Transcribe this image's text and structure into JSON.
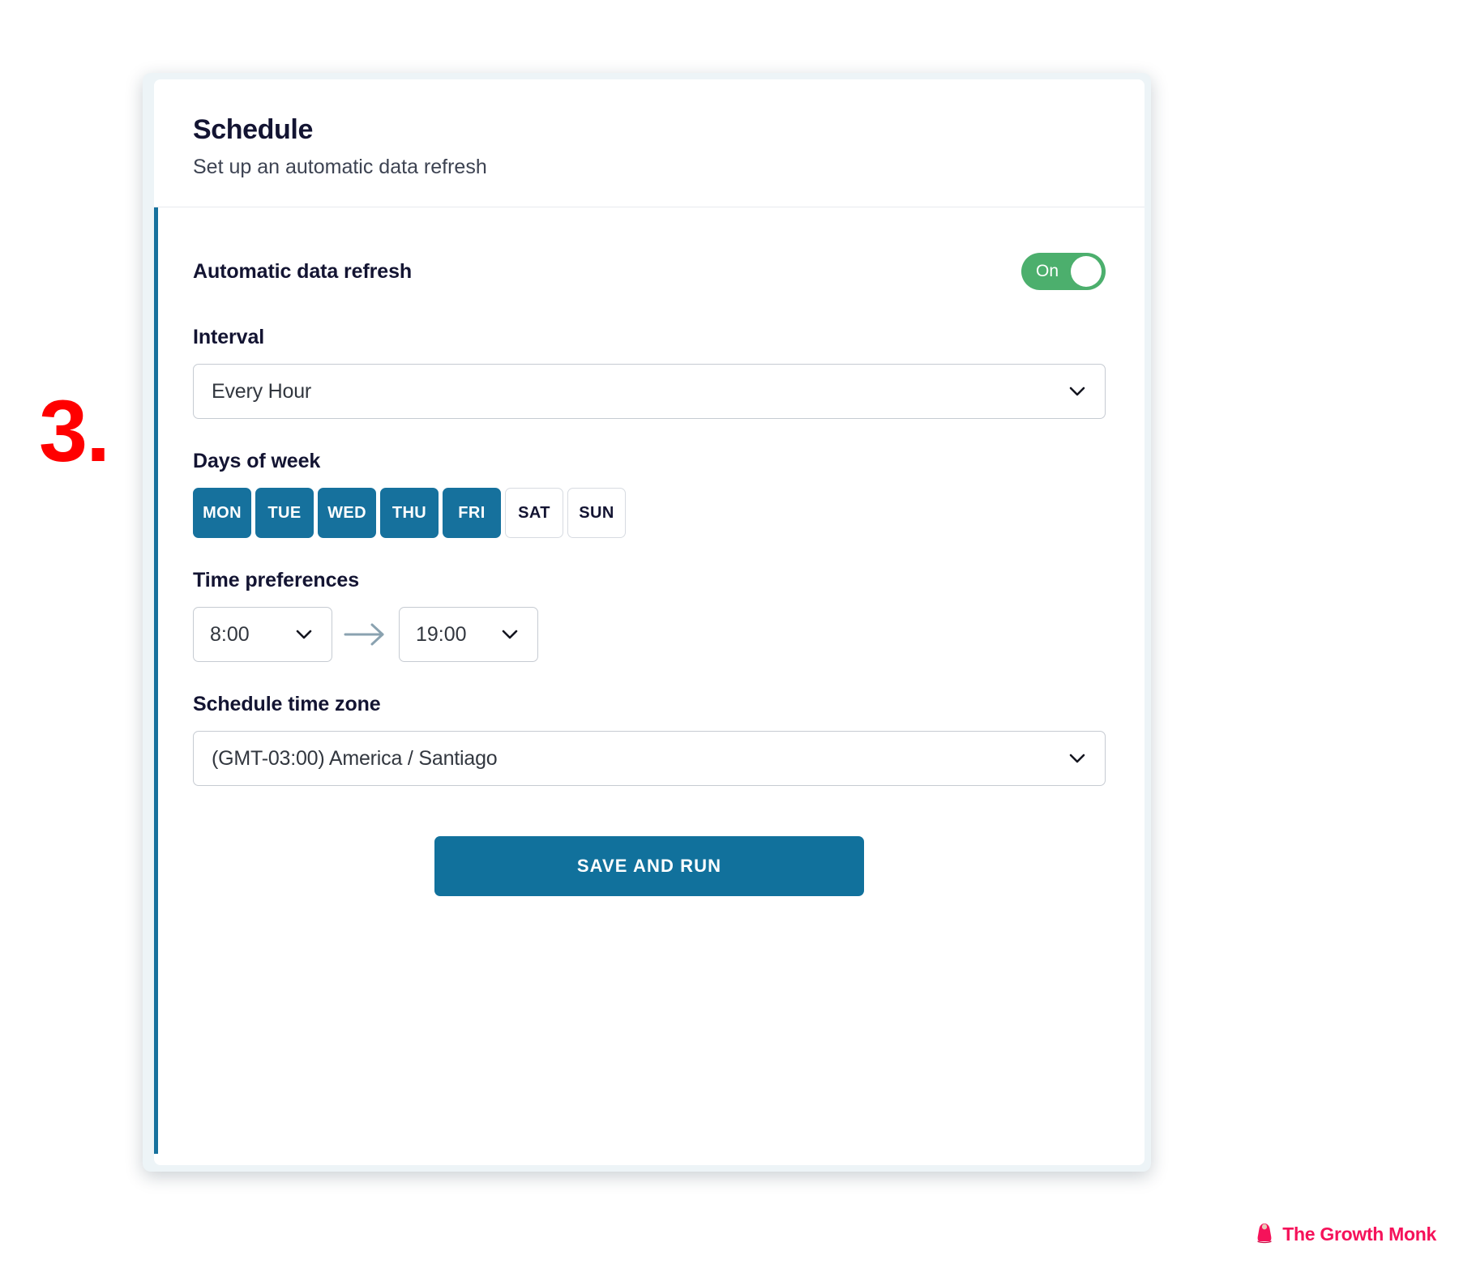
{
  "annotation": {
    "step": "3."
  },
  "card": {
    "header": {
      "title": "Schedule",
      "subtitle": "Set up an automatic data refresh"
    },
    "auto_refresh": {
      "label": "Automatic data refresh",
      "toggle_state": "On",
      "toggle_color": "#4caf6d"
    },
    "interval": {
      "label": "Interval",
      "value": "Every Hour",
      "chevron": "chevron-down-icon"
    },
    "days_of_week": {
      "label": "Days of week",
      "selected_color": "#16719d",
      "days": [
        {
          "label": "MON",
          "selected": true
        },
        {
          "label": "TUE",
          "selected": true
        },
        {
          "label": "WED",
          "selected": true
        },
        {
          "label": "THU",
          "selected": true
        },
        {
          "label": "FRI",
          "selected": true
        },
        {
          "label": "SAT",
          "selected": false
        },
        {
          "label": "SUN",
          "selected": false
        }
      ]
    },
    "time_preferences": {
      "label": "Time preferences",
      "start": "8:00",
      "end": "19:00",
      "separator_icon": "arrow-right-icon"
    },
    "time_zone": {
      "label": "Schedule time zone",
      "value": "(GMT-03:00) America / Santiago",
      "chevron": "chevron-down-icon"
    },
    "actions": {
      "save_label": "SAVE AND RUN",
      "save_color": "#11719c"
    },
    "accent_color": "#16719d"
  },
  "watermark": {
    "text": "The Growth Monk",
    "color": "#f5125a",
    "icon": "monk-icon"
  }
}
